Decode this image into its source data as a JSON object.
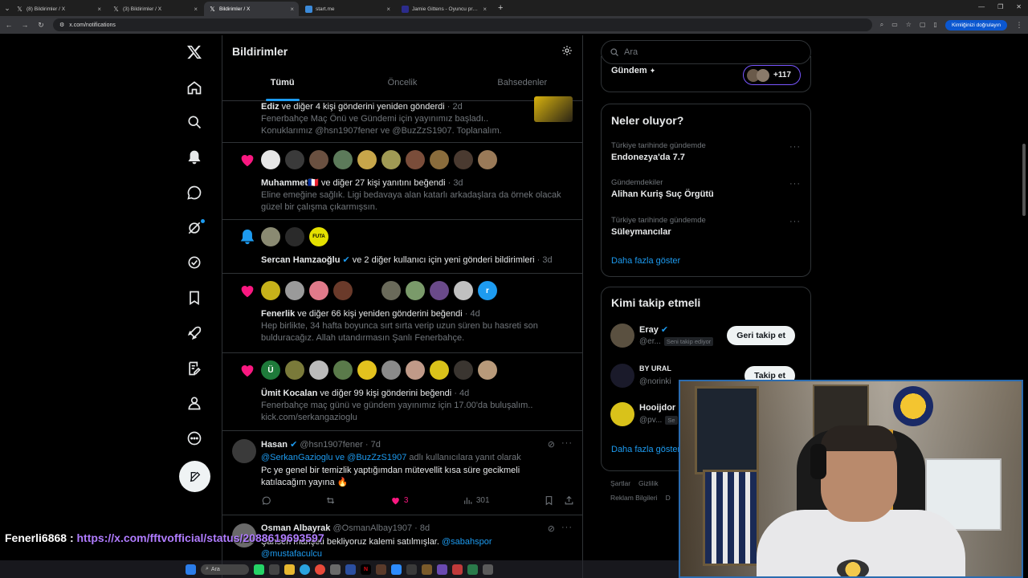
{
  "browser": {
    "tabs": [
      {
        "title": "(8) Bildirimler / X",
        "active": false
      },
      {
        "title": "(3) Bildirimler / X",
        "active": false
      },
      {
        "title": "Bildirimler / X",
        "active": true
      },
      {
        "title": "start.me",
        "active": false
      },
      {
        "title": "Jamie Gittens - Oyuncu profili 2",
        "active": false
      }
    ],
    "url": "x.com/notifications",
    "verify_label": "Kimliğinizi doğrulayın"
  },
  "header": {
    "title": "Bildirimler",
    "tabs": [
      "Tümü",
      "Öncelik",
      "Bahsedenler"
    ]
  },
  "notifications": [
    {
      "name": "Ediz",
      "action": " ve diğer 4 kişi gönderini yeniden gönderdi",
      "time": "· 2d",
      "preview": "Fenerbahçe Maç Önü ve Gündemi için yayınımız başladı.. Konuklarımız @hsn1907fener ve @BuzZzS1907. Toplanalım."
    },
    {
      "name": "Muhammet",
      "flag": "🇫🇷",
      "action": " ve diğer 27 kişi yanıtını beğendi",
      "time": "· 3d",
      "preview": "Eline emeğine sağlık. Ligi bedavaya alan katarlı arkadaşlara da örnek olacak güzel bir çalışma çıkarmışsın."
    },
    {
      "name": "Sercan Hamzaoğlu",
      "action": " ve 2 diğer kullanıcı için yeni gönderi bildirimleri",
      "time": "· 3d",
      "avatar_text": "FUTA"
    },
    {
      "name": "Fenerlik",
      "action": " ve diğer 66 kişi yeniden gönderini beğendi",
      "time": "· 4d",
      "preview": "Hep birlikte, 34 hafta boyunca sırt sırta verip uzun süren bu hasreti son bulduracağız. Allah utandırmasın Şanlı Fenerbahçe.",
      "avatar_letter": "r"
    },
    {
      "name": "Ümit Kocalan",
      "action": " ve diğer 99 kişi gönderini beğendi",
      "time": "· 4d",
      "preview": "Fenerbahçe maç günü ve gündem yayınımız için 17.00'da buluşalım.. kick.com/serkangazioglu",
      "avatar_letter": "Ü"
    }
  ],
  "tweets": [
    {
      "name": "Hasan",
      "handle": "@hsn1907fener",
      "time": "· 7d",
      "reply_to": "@SerkanGazioglu ve @BuzZzS1907",
      "reply_suffix": " adlı kullanıcılara yanıt olarak",
      "text": "Pc ye genel bir temizlik yaptığımdan mütevellit kısa süre gecikmeli katılacağım yayına 🔥",
      "likes": "3",
      "views": "301"
    },
    {
      "name": "Osman Albayrak",
      "handle": "@OsmanAlbay1907",
      "time": "· 8d",
      "text": "Şahsen manşeti bekliyoruz kalemi satılmışlar.",
      "mention1": "@sabahspor",
      "mention2": "@mustafaculcu"
    }
  ],
  "sidebar": {
    "search_placeholder": "Ara",
    "gundem_label": "Gündem",
    "gundem_count": "+117",
    "whats_happening": {
      "title": "Neler oluyor?",
      "trends": [
        {
          "context": "Türkiye tarihinde gündemde",
          "name": "Endonezya'da 7.7"
        },
        {
          "context": "Gündemdekiler",
          "name": "Alihan Kuriş Suç Örgütü"
        },
        {
          "context": "Türkiye tarihinde gündemde",
          "name": "Süleymancılar"
        }
      ],
      "show_more": "Daha fazla göster"
    },
    "who_to_follow": {
      "title": "Kimi takip etmeli",
      "users": [
        {
          "name": "Eray",
          "handle": "@er...",
          "badge": "Seni takip ediyor",
          "button": "Geri takip et"
        },
        {
          "name": "BY URAL",
          "handle": "@norinki",
          "button": "Takip et"
        },
        {
          "name": "Hooijdor",
          "handle": "@pv...",
          "badge": "Se"
        }
      ],
      "show_more": "Daha fazla göster"
    },
    "footer": [
      "Şartlar",
      "Gizlilik",
      "Reklam Bilgileri",
      "D"
    ]
  },
  "chat": {
    "user": "Fenerli6868 :",
    "message": " https://x.com/fftvofficial/status/2088619693597"
  },
  "taskbar": {
    "search_label": "Ara"
  },
  "colors": {
    "accent": "#1d9bf0",
    "like": "#f91880",
    "background": "#000000"
  }
}
